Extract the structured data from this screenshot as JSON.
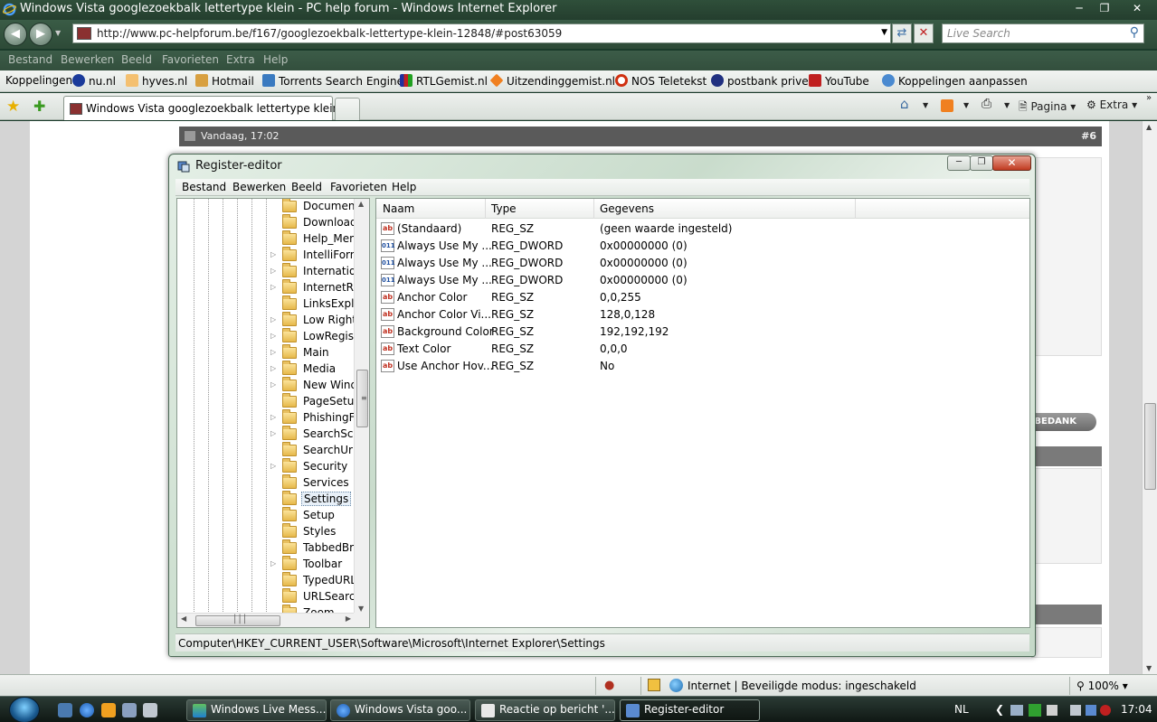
{
  "ie": {
    "title": "Windows Vista googlezoekbalk lettertype klein - PC help forum - Windows Internet Explorer",
    "url": "http://www.pc-helpforum.be/f167/googlezoekbalk-lettertype-klein-12848/#post63059",
    "search_placeholder": "Live Search",
    "menu": [
      "Bestand",
      "Bewerken",
      "Beeld",
      "Favorieten",
      "Extra",
      "Help"
    ],
    "links_label": "Koppelingen",
    "links": [
      "nu.nl",
      "hyves.nl",
      "Hotmail",
      "Torrents Search Engine",
      "RTLGemist.nl",
      "Uitzendinggemist.nl",
      "NOS Teletekst",
      "postbank prive",
      "YouTube",
      "Koppelingen aanpassen"
    ],
    "tab_label": "Windows Vista googlezoekbalk lettertype klein - ...",
    "cmd_page": "Pagina",
    "cmd_extra": "Extra",
    "status_zone": "Internet | Beveiligde modus: ingeschakeld",
    "zoom": "100%"
  },
  "webpage": {
    "post_date": "Vandaag, 17:02",
    "post_number": "#6",
    "bedank_label": "BEDANK"
  },
  "regedit": {
    "title": "Register-editor",
    "menu": [
      "Bestand",
      "Bewerken",
      "Beeld",
      "Favorieten",
      "Help"
    ],
    "tree": [
      {
        "label": "Document",
        "expandable": false
      },
      {
        "label": "Download",
        "expandable": false
      },
      {
        "label": "Help_Menu",
        "expandable": false
      },
      {
        "label": "IntelliForm",
        "expandable": true
      },
      {
        "label": "Internation",
        "expandable": true
      },
      {
        "label": "InternetReg",
        "expandable": true
      },
      {
        "label": "LinksExplor",
        "expandable": false
      },
      {
        "label": "Low Rights",
        "expandable": true
      },
      {
        "label": "LowRegistr",
        "expandable": true
      },
      {
        "label": "Main",
        "expandable": true
      },
      {
        "label": "Media",
        "expandable": true
      },
      {
        "label": "New Windo",
        "expandable": true
      },
      {
        "label": "PageSetup",
        "expandable": false
      },
      {
        "label": "PhishingFil",
        "expandable": true
      },
      {
        "label": "SearchScop",
        "expandable": true
      },
      {
        "label": "SearchUrl",
        "expandable": false
      },
      {
        "label": "Security",
        "expandable": true
      },
      {
        "label": "Services",
        "expandable": false
      },
      {
        "label": "Settings",
        "expandable": false,
        "selected": true
      },
      {
        "label": "Setup",
        "expandable": false
      },
      {
        "label": "Styles",
        "expandable": false
      },
      {
        "label": "TabbedBro",
        "expandable": false
      },
      {
        "label": "Toolbar",
        "expandable": true
      },
      {
        "label": "TypedURLs",
        "expandable": false
      },
      {
        "label": "URLSearch",
        "expandable": false
      },
      {
        "label": "Zoom",
        "expandable": false
      }
    ],
    "columns": [
      "Naam",
      "Type",
      "Gegevens"
    ],
    "rows": [
      {
        "icon": "string",
        "name": "(Standaard)",
        "type": "REG_SZ",
        "data": "(geen waarde ingesteld)"
      },
      {
        "icon": "dword",
        "name": "Always Use My ...",
        "type": "REG_DWORD",
        "data": "0x00000000 (0)"
      },
      {
        "icon": "dword",
        "name": "Always Use My ...",
        "type": "REG_DWORD",
        "data": "0x00000000 (0)"
      },
      {
        "icon": "dword",
        "name": "Always Use My ...",
        "type": "REG_DWORD",
        "data": "0x00000000 (0)"
      },
      {
        "icon": "string",
        "name": "Anchor Color",
        "type": "REG_SZ",
        "data": "0,0,255"
      },
      {
        "icon": "string",
        "name": "Anchor Color Vi...",
        "type": "REG_SZ",
        "data": "128,0,128"
      },
      {
        "icon": "string",
        "name": "Background Color",
        "type": "REG_SZ",
        "data": "192,192,192"
      },
      {
        "icon": "string",
        "name": "Text Color",
        "type": "REG_SZ",
        "data": "0,0,0"
      },
      {
        "icon": "string",
        "name": "Use Anchor Hov...",
        "type": "REG_SZ",
        "data": "No"
      }
    ],
    "status_path": "Computer\\HKEY_CURRENT_USER\\Software\\Microsoft\\Internet Explorer\\Settings"
  },
  "taskbar": {
    "buttons": [
      "Windows Live Mess...",
      "Windows Vista goo...",
      "Reactie op bericht '...",
      "Register-editor"
    ],
    "lang": "NL",
    "clock": "17:04"
  }
}
